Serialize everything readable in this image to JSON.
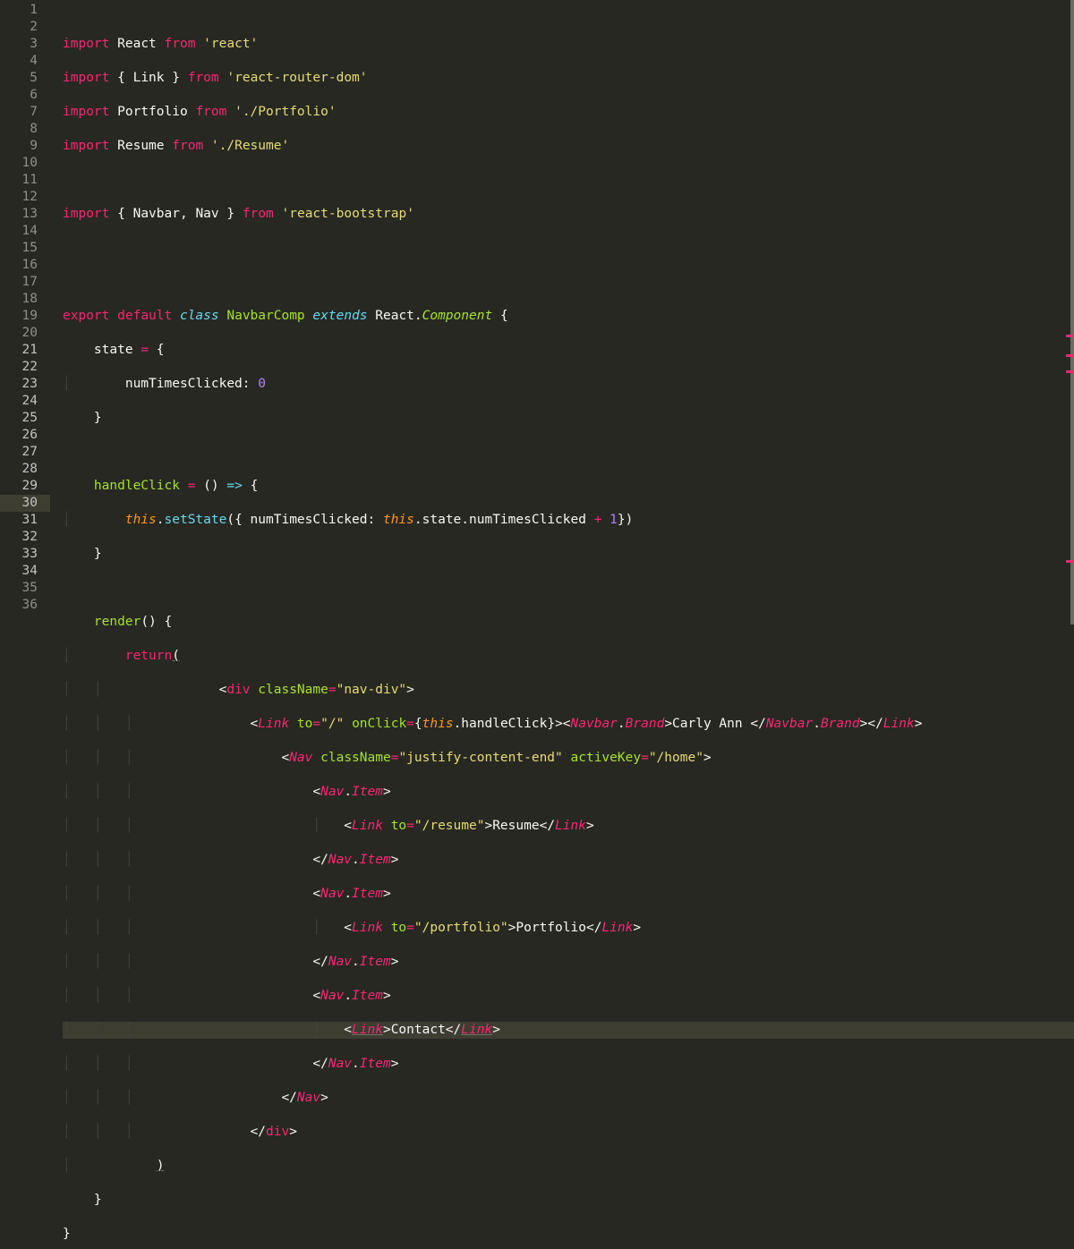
{
  "line_numbers": [
    "1",
    "2",
    "3",
    "4",
    "5",
    "6",
    "7",
    "8",
    "9",
    "10",
    "11",
    "12",
    "13",
    "14",
    "15",
    "16",
    "17",
    "18",
    "19",
    "20",
    "21",
    "22",
    "23",
    "24",
    "25",
    "26",
    "27",
    "28",
    "29",
    "30",
    "31",
    "32",
    "33",
    "34",
    "35",
    "36"
  ],
  "active_line_index": 29,
  "highlight_numbers": [
    20,
    21,
    22,
    23,
    24,
    25,
    26,
    27,
    28,
    29,
    30,
    31,
    32,
    33
  ],
  "tokens": {
    "kw_import": "import",
    "kw_from": "from",
    "kw_export": "export",
    "kw_default": "default",
    "kw_class": "class",
    "kw_extends": "extends",
    "kw_return": "return",
    "id_React": "React",
    "id_Link": "Link",
    "id_Portfolio": "Portfolio",
    "id_Resume": "Resume",
    "id_Navbar": "Navbar",
    "id_Nav": "Nav",
    "id_NavbarComp": "NavbarComp",
    "id_Component": "Component",
    "id_state": "state",
    "id_numTimesClicked": "numTimesClicked",
    "id_handleClick": "handleClick",
    "id_setState": "setState",
    "id_this": "this",
    "id_render": "render",
    "id_div": "div",
    "id_to": "to",
    "id_onClick": "onClick",
    "id_className": "className",
    "id_activeKey": "activeKey",
    "id_Brand": "Brand",
    "id_Item": "Item",
    "str_react": "'react'",
    "str_rrd": "'react-router-dom'",
    "str_portfolio": "'./Portfolio'",
    "str_resume": "'./Resume'",
    "str_bootstrap": "'react-bootstrap'",
    "str_navdiv": "\"nav-div\"",
    "str_root": "\"/\"",
    "str_justify": "\"justify-content-end\"",
    "str_home": "\"/home\"",
    "str_resume2": "\"/resume\"",
    "str_portfolio2": "\"/portfolio\"",
    "txt_Resume": "Resume",
    "txt_Portfolio": "Portfolio",
    "txt_Contact": "Contact",
    "txt_Carly": "Carly Ann ",
    "num_0": "0",
    "num_1": "1",
    "p_obr": "{",
    "p_cbr": "}",
    "p_op": "(",
    "p_cp": ")",
    "p_lt": "<",
    "p_gt": ">",
    "p_sl": "/",
    "p_ltcl": "</",
    "p_comma": ", ",
    "p_dot": ".",
    "p_eq": "=",
    "p_colon": ": ",
    "p_plus": "+",
    "p_arrow": "=>",
    "p_sp": " "
  },
  "indent": {
    "i1": "    ",
    "i2": "        ",
    "i3": "            ",
    "i4": "                ",
    "i5": "                    ",
    "i6": "                        ",
    "i7": "                            "
  },
  "guides": {
    "g1": "│   ",
    "g2": "│   │   ",
    "g3": "│   │   │   "
  }
}
